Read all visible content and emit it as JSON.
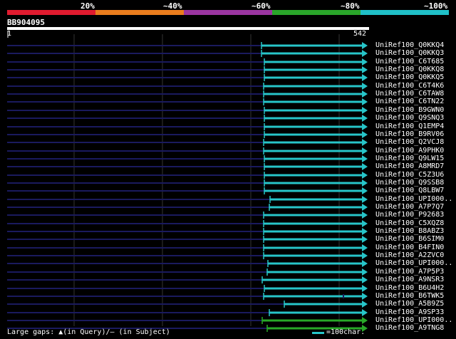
{
  "legend": {
    "labels": [
      "20%",
      "~40%",
      "~60%",
      "~80%",
      "~100%"
    ],
    "colors": [
      "#e01b2f",
      "#ea7d1e",
      "#9a35a0",
      "#2aa52a",
      "#20c0c8"
    ]
  },
  "query": {
    "title": "BB904095",
    "start": "1",
    "end": "542"
  },
  "colors": {
    "query_bar": "#ffffff",
    "gap": "#1a1a5e",
    "grid": "#333333",
    "teal": "#27c5c9",
    "green": "#28a828"
  },
  "hits": [
    {
      "label": "UniRef100_Q0KKQ4",
      "color": "teal"
    },
    {
      "label": "UniRef100_Q0KKQ3",
      "color": "teal"
    },
    {
      "label": "UniRef100_C6T685",
      "color": "teal"
    },
    {
      "label": "UniRef100_Q0KKQ8",
      "color": "teal"
    },
    {
      "label": "UniRef100_Q0KKQ5",
      "color": "teal"
    },
    {
      "label": "UniRef100_C6T4K6",
      "color": "teal"
    },
    {
      "label": "UniRef100_C6TAW8",
      "color": "teal"
    },
    {
      "label": "UniRef100_C6TN22",
      "color": "teal"
    },
    {
      "label": "UniRef100_B9GWN0",
      "color": "teal"
    },
    {
      "label": "UniRef100_Q9SNQ3",
      "color": "teal"
    },
    {
      "label": "UniRef100_Q1EMP4",
      "color": "teal"
    },
    {
      "label": "UniRef100_B9RV06",
      "color": "teal"
    },
    {
      "label": "UniRef100_Q2VCJ8",
      "color": "teal"
    },
    {
      "label": "UniRef100_A9PHK0",
      "color": "teal"
    },
    {
      "label": "UniRef100_Q9LW15",
      "color": "teal"
    },
    {
      "label": "UniRef100_A8MRD7",
      "color": "teal"
    },
    {
      "label": "UniRef100_C5Z3U6",
      "color": "teal"
    },
    {
      "label": "UniRef100_Q9SSB8",
      "color": "teal"
    },
    {
      "label": "UniRef100_Q8LBW7",
      "color": "teal"
    },
    {
      "label": "UniRef100_UPI000..",
      "color": "teal"
    },
    {
      "label": "UniRef100_A7P7Q7",
      "color": "teal"
    },
    {
      "label": "UniRef100_P92683",
      "color": "teal"
    },
    {
      "label": "UniRef100_C5XQZ8",
      "color": "teal"
    },
    {
      "label": "UniRef100_B8ABZ3",
      "color": "teal"
    },
    {
      "label": "UniRef100_B6SIM0",
      "color": "teal"
    },
    {
      "label": "UniRef100_B4FIN0",
      "color": "teal"
    },
    {
      "label": "UniRef100_A2ZVC0",
      "color": "teal"
    },
    {
      "label": "UniRef100_UPI000..",
      "color": "teal"
    },
    {
      "label": "UniRef100_A7P5P3",
      "color": "teal"
    },
    {
      "label": "UniRef100_A9NSR3",
      "color": "teal"
    },
    {
      "label": "UniRef100_B6U4H2",
      "color": "teal"
    },
    {
      "label": "UniRef100_B6TWK5",
      "color": "teal"
    },
    {
      "label": "UniRef100_A5B9Z5",
      "color": "teal"
    },
    {
      "label": "UniRef100_A9SP33",
      "color": "teal"
    },
    {
      "label": "UniRef100_UPI000..",
      "color": "green"
    },
    {
      "label": "UniRef100_A9TNG8",
      "color": "green"
    }
  ],
  "footer": {
    "gaps_text": "Large gaps: ▲(in Query)/— (in Subject)",
    "scale_text": "=100char."
  }
}
